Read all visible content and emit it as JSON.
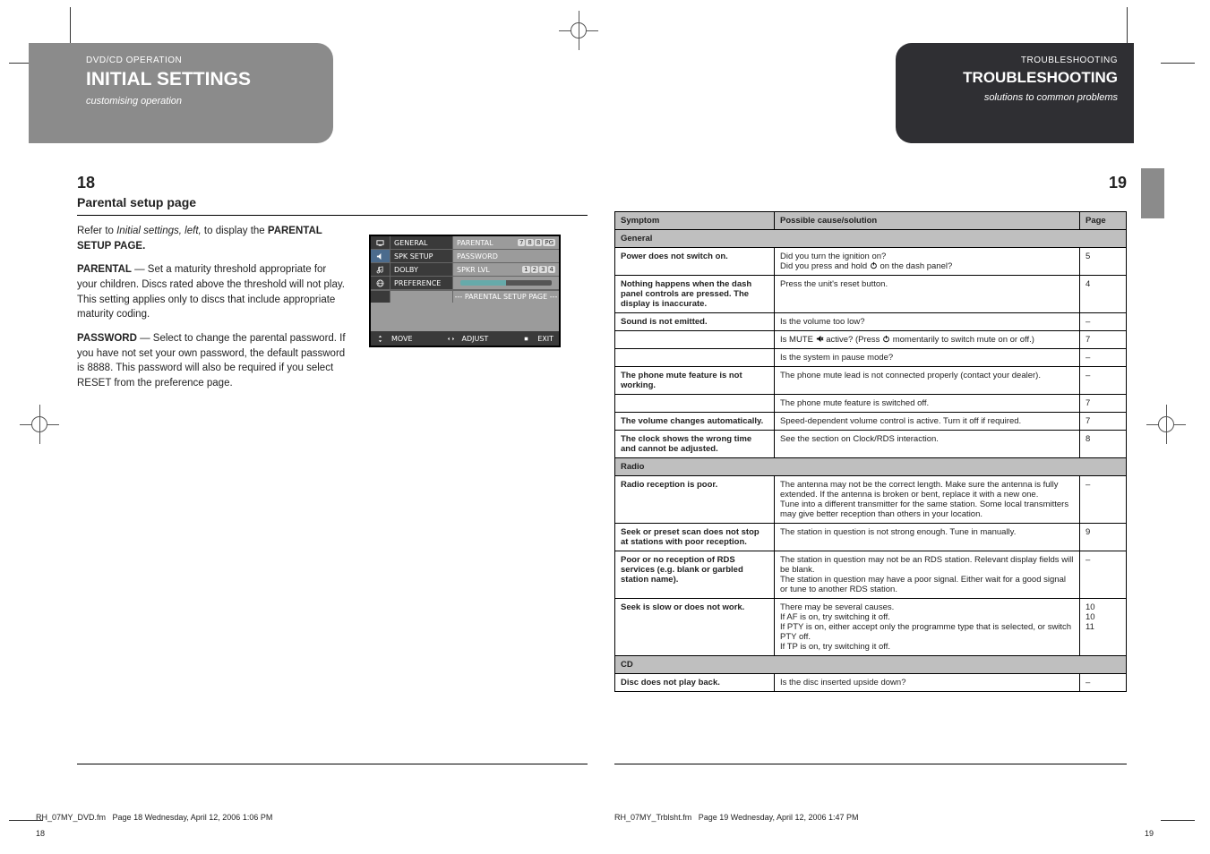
{
  "left": {
    "page_number": "18",
    "header_small": "DVD/CD OPERATION",
    "header_title": "INITIAL SETTINGS",
    "header_sub_italic": "customising operation",
    "section_title": "Parental setup page",
    "para1_before_italic": "Refer to ",
    "para1_italic": "Initial settings, left,",
    "para1_after_italic": " to display the ",
    "para1_bold": "PARENTAL SETUP PAGE.",
    "definitions": [
      {
        "term": "PARENTAL",
        "text": "— Set a maturity threshold appropriate for your children. Discs rated above the threshold will not play. This setting applies only to discs that include appropriate maturity coding."
      },
      {
        "term": "PASSWORD",
        "text": "— Select to change the parental password. If you have not set your own password, the default password is 8888. This password will also be required if you select RESET from the preference page."
      }
    ],
    "osd": {
      "rows": [
        {
          "label": "GENERAL"
        },
        {
          "label": "SPK SETUP"
        },
        {
          "label": "DOLBY"
        },
        {
          "label": "PREFERENCE"
        }
      ],
      "right_rows": [
        {
          "label": "PARENTAL",
          "digits": [
            "7",
            "8",
            "8",
            "PG"
          ]
        },
        {
          "label": "PASSWORD"
        },
        {
          "label": "SPKR LVL",
          "digits": [
            "1",
            "2",
            "3",
            "4"
          ]
        },
        {
          "label": "SLIDER"
        }
      ],
      "caption": "--- PARENTAL SETUP PAGE ---",
      "bottom": {
        "move_label": "MOVE",
        "adjust_label": "ADJUST",
        "exit_label": "EXIT"
      }
    },
    "foot_file": "RH_07MY_DVD.fm",
    "foot_pagestamp": "Page 18  Wednesday, April 12, 2006  1:06 PM",
    "corner_page": "18"
  },
  "right": {
    "page_number": "19",
    "header_small": "TROUBLESHOOTING",
    "header_title": "TROUBLESHOOTING",
    "header_sub_italic": "solutions to common problems",
    "table": {
      "headers": [
        "Symptom",
        "Possible cause/solution",
        "Page"
      ],
      "sections": [
        {
          "title": "General",
          "rows": [
            {
              "sym": "Power does not switch on.",
              "cause": "Did you turn the ignition on?\nDid you press and hold __POWER__ on the dash panel?",
              "page": "5"
            },
            {
              "sym": "Nothing happens when the dash panel controls are pressed. The display is inaccurate.",
              "cause": "Press the unit's reset button.",
              "page": "4"
            },
            {
              "sym": "Sound is not emitted.",
              "cause": "Is the volume too low?",
              "page": "–"
            },
            {
              "sym": "",
              "cause": "Is MUTE __MUTE__ active? (Press __POWER__ momentarily to switch mute on or off.)",
              "page": "7"
            },
            {
              "sym": "",
              "cause": "Is the system in pause mode?",
              "page": "–"
            },
            {
              "sym": "The phone mute feature is not working.",
              "cause": "The phone mute lead is not connected properly (contact your dealer).",
              "page": "–"
            },
            {
              "sym": "",
              "cause": "The phone mute feature is switched off.",
              "page": "7"
            },
            {
              "sym": "The volume changes automatically.",
              "cause": "Speed-dependent volume control is active. Turn it off if required.",
              "page": "7"
            },
            {
              "sym": "The clock shows the wrong time and cannot be adjusted.",
              "cause": "See the section on Clock/RDS interaction.",
              "page": "8"
            }
          ]
        },
        {
          "title": "Radio",
          "rows": [
            {
              "sym": "Radio reception is poor.",
              "cause": "The antenna may not be the correct length. Make sure the antenna is fully extended. If the antenna is broken or bent, replace it with a new one.\nTune into a different transmitter for the same station. Some local transmitters may give better reception than others in your location.",
              "page": "–"
            },
            {
              "sym": "Seek or preset scan does not stop at stations with poor reception.",
              "cause": "The station in question is not strong enough. Tune in manually.",
              "page": "9"
            },
            {
              "sym": "Poor or no reception of RDS services (e.g. blank or garbled station name).",
              "cause": "The station in question may not be an RDS station. Relevant display fields will be blank.\nThe station in question may have a poor signal. Either wait for a good signal or tune to another RDS station.",
              "page": "–"
            },
            {
              "sym": "Seek is slow or does not work.",
              "cause": "There may be several causes.\nIf AF is on, try switching it off.\nIf PTY is on, either accept only the programme type that is selected, or switch PTY off.\nIf TP is on, try switching it off.",
              "page": "10\n10\n11"
            }
          ]
        },
        {
          "title": "CD",
          "rows": [
            {
              "sym": "Disc does not play back.",
              "cause": "Is the disc inserted upside down?",
              "page": "–"
            }
          ]
        }
      ]
    },
    "foot_file": "RH_07MY_Trblsht.fm",
    "foot_pagestamp": "Page 19  Wednesday, April 12, 2006  1:47 PM",
    "corner_page": "19"
  }
}
